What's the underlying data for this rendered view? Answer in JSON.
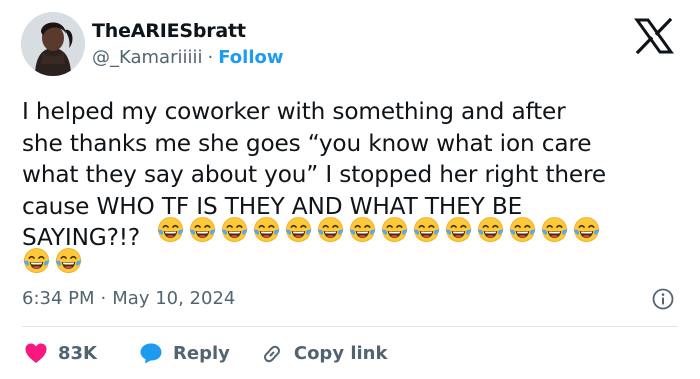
{
  "author": {
    "name": "TheARIESbratt",
    "handle": "@_Kamariiiii",
    "separator": "·",
    "follow_label": "Follow"
  },
  "tweet": {
    "text": "I helped my coworker with something and after\nshe thanks me she goes “you know what ion care\nwhat they say about you” I stopped her right there\ncause WHO TF IS THEY AND WHAT THEY BE\nSAYING?!?",
    "emoji": "😂",
    "emoji_count": 16
  },
  "meta": {
    "time": "6:34 PM",
    "separator": "·",
    "date": "May 10, 2024"
  },
  "actions": {
    "like_count": "83K",
    "reply_label": "Reply",
    "copy_label": "Copy link"
  },
  "colors": {
    "like": "#f91880",
    "reply": "#1d9bf0",
    "follow": "#1d9bf0",
    "muted": "#536471",
    "text": "#0f1419"
  },
  "icons": {
    "brand": "x-logo-icon",
    "info": "info-icon",
    "like": "heart-icon",
    "reply": "speech-bubble-icon",
    "copy": "link-icon",
    "emoji": "face-with-tears-of-joy-icon"
  }
}
